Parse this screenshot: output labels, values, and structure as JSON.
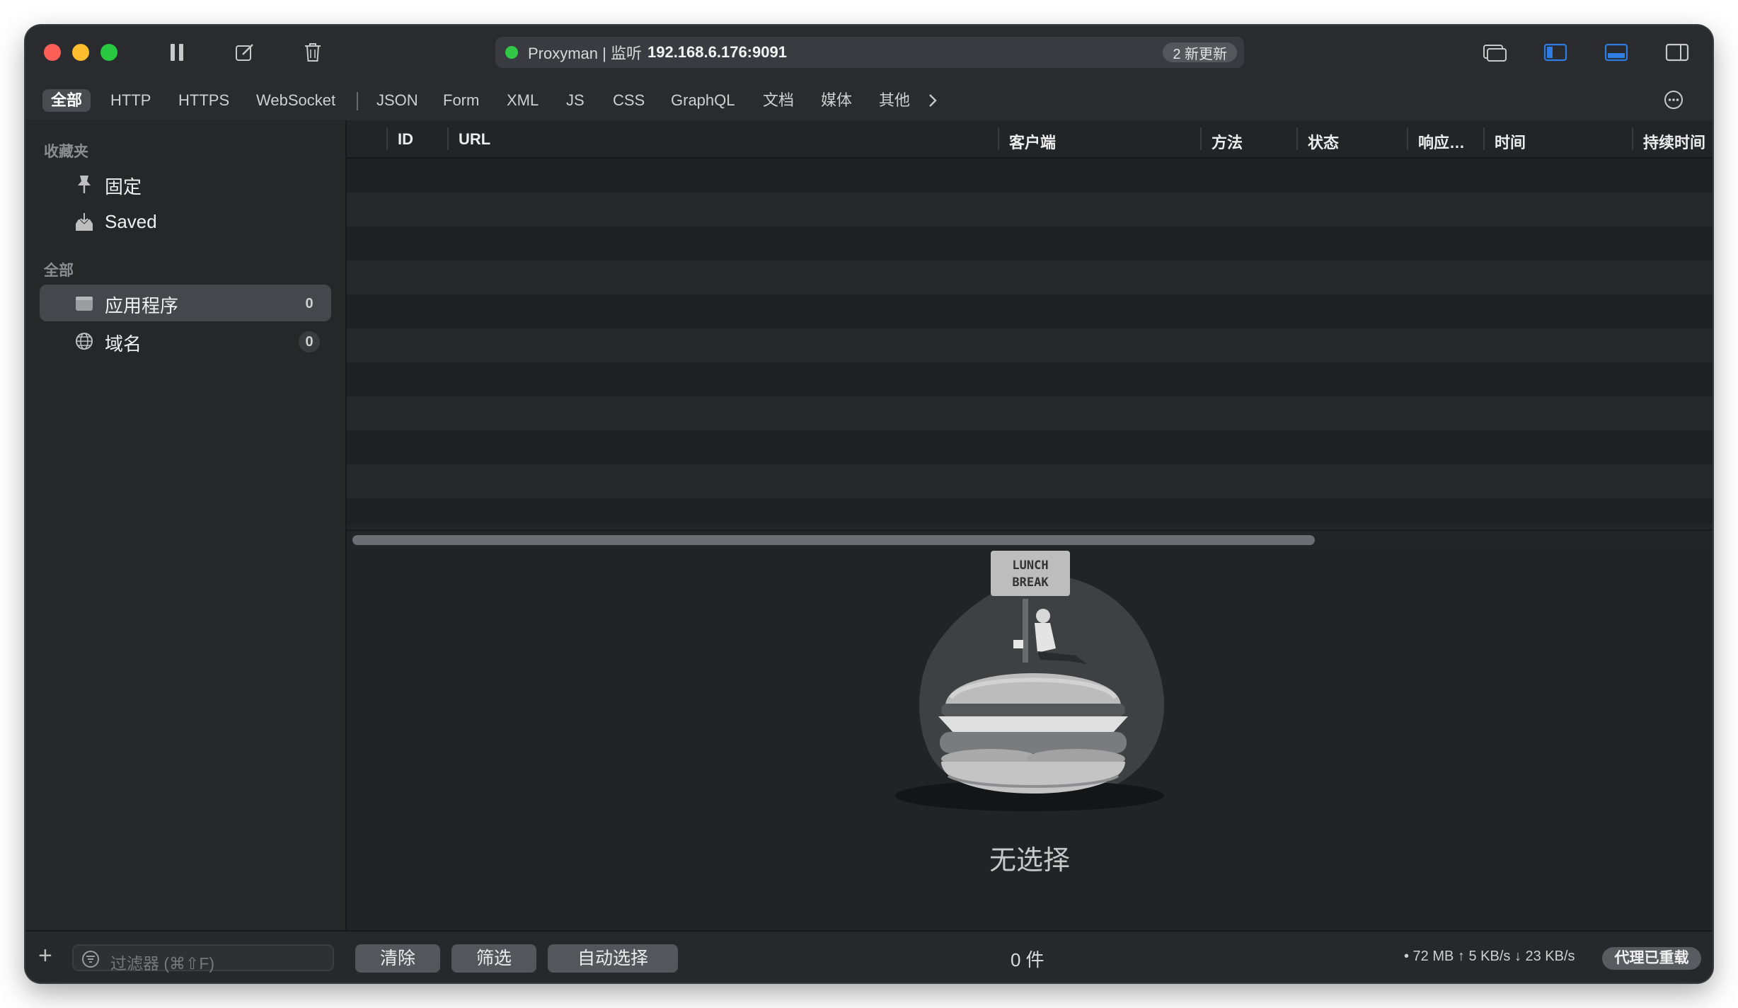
{
  "titlebar": {
    "app_title": "Proxyman | 监听",
    "listen_address": "192.168.6.176:9091",
    "update_badge": "2 新更新"
  },
  "filter_tabs": [
    "全部",
    "HTTP",
    "HTTPS",
    "WebSocket",
    "JSON",
    "Form",
    "XML",
    "JS",
    "CSS",
    "GraphQL",
    "文档",
    "媒体",
    "其他"
  ],
  "sidebar": {
    "favorites_header": "收藏夹",
    "favorites": [
      {
        "label": "固定",
        "icon": "pin-icon"
      },
      {
        "label": "Saved",
        "icon": "tray-icon"
      }
    ],
    "all_header": "全部",
    "all_items": [
      {
        "label": "应用程序",
        "count": "0",
        "icon": "app-folder-icon"
      },
      {
        "label": "域名",
        "count": "0",
        "icon": "globe-icon"
      }
    ]
  },
  "table": {
    "columns": [
      "ID",
      "URL",
      "客户端",
      "方法",
      "状态",
      "响应…",
      "时间",
      "持续时间"
    ]
  },
  "detail": {
    "empty_label": "无选择",
    "sign_text_line1": "LUNCH",
    "sign_text_line2": "BREAK"
  },
  "bottombar": {
    "filter_placeholder": "过滤器 (⌘⇧F)",
    "clear_label": "清除",
    "filter_label": "筛选",
    "autoselect_label": "自动选择",
    "count_label": "0 件",
    "stats": "• 72 MB ↑ 5 KB/s ↓ 23 KB/s",
    "proxy_status": "代理已重载"
  },
  "colors": {
    "status_dot": "#33c748",
    "window_bg": "#232428",
    "accent_blue": "#2f7de1"
  }
}
